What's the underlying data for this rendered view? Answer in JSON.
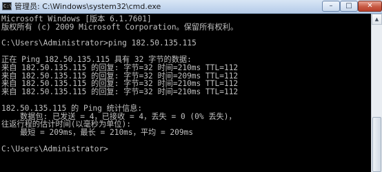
{
  "window": {
    "title": "管理员: C:\\Windows\\system32\\cmd.exe",
    "app_icon_text": "C:\\",
    "minimize_label": "–",
    "maximize_label": "□",
    "close_label": "✕"
  },
  "console": {
    "lines": [
      "Microsoft Windows [版本 6.1.7601]",
      "版权所有 (c) 2009 Microsoft Corporation。保留所有权利。",
      "",
      "C:\\Users\\Administrator>ping 182.50.135.115",
      "",
      "正在 Ping 182.50.135.115 具有 32 字节的数据:",
      "来自 182.50.135.115 的回复: 字节=32 时间=210ms TTL=112",
      "来自 182.50.135.115 的回复: 字节=32 时间=209ms TTL=112",
      "来自 182.50.135.115 的回复: 字节=32 时间=210ms TTL=112",
      "来自 182.50.135.115 的回复: 字节=32 时间=210ms TTL=112",
      "",
      "182.50.135.115 的 Ping 统计信息:",
      "    数据包: 已发送 = 4，已接收 = 4，丢失 = 0 (0% 丢失)，",
      "往返行程的估计时间(以毫秒为单位):",
      "    最短 = 209ms，最长 = 210ms，平均 = 209ms",
      "",
      "C:\\Users\\Administrator>"
    ]
  },
  "scrollbar": {
    "up_arrow": "▲"
  },
  "colors": {
    "console_background": "#000000",
    "console_text": "#c0c0c0",
    "close_button": "#c75a43"
  }
}
